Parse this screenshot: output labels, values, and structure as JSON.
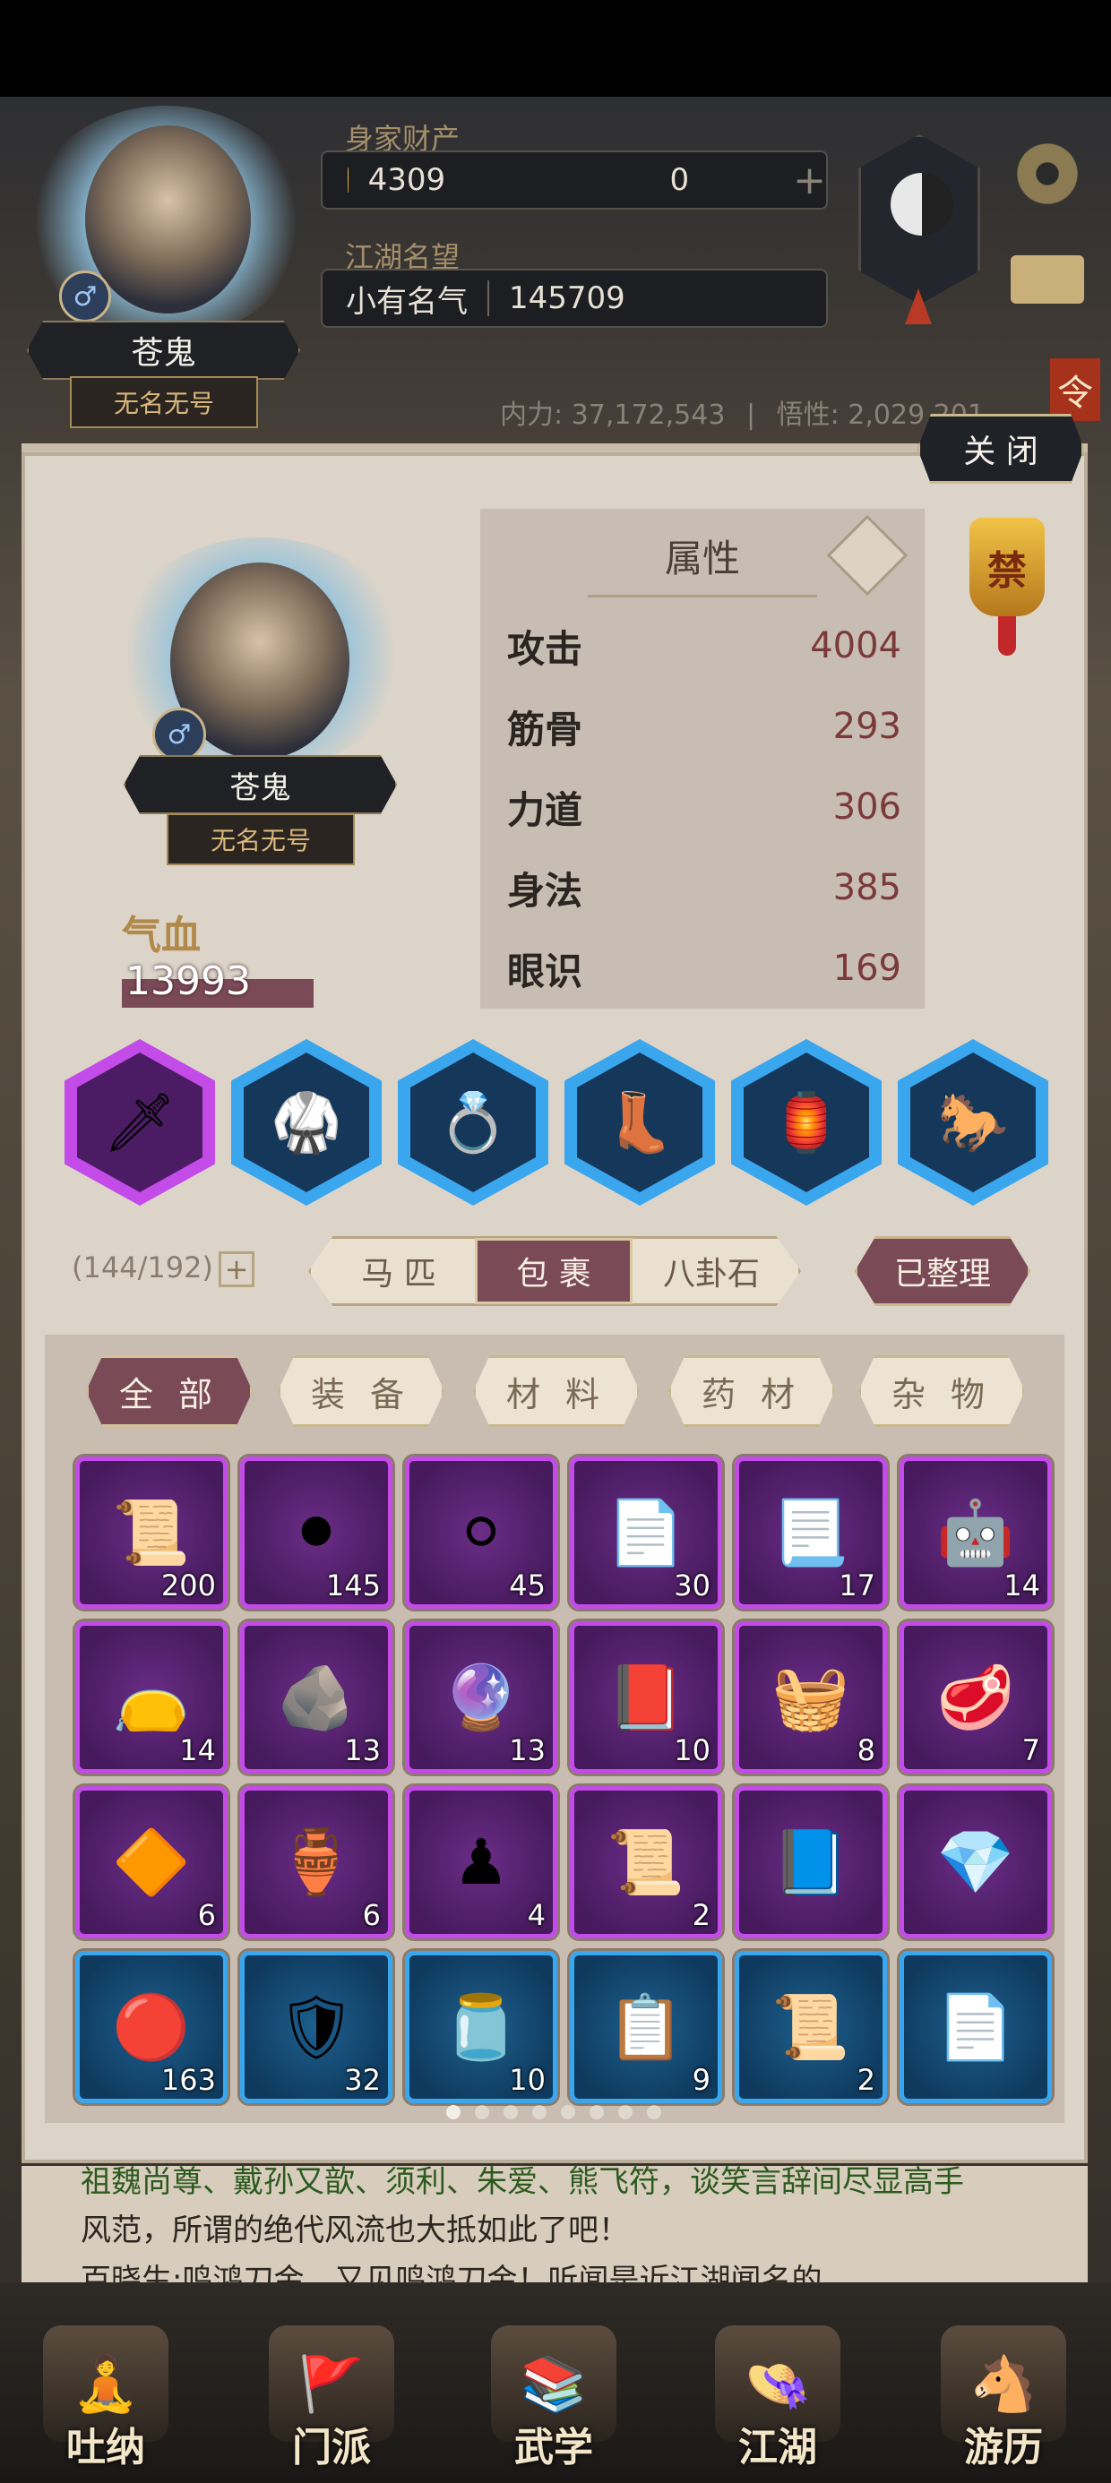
{
  "header": {
    "char_name": "苍鬼",
    "char_title": "无名无号",
    "gender_symbol": "♂",
    "wealth_label": "身家财产",
    "gold": "4309",
    "jade": "0",
    "add_symbol": "+",
    "fame_label": "江湖名望",
    "fame_level": "小有名气",
    "fame_value": "145709",
    "inner_power_label": "内力:",
    "inner_power": "37,172,543",
    "comprehension_label": "悟性:",
    "comprehension": "2,029,201",
    "side_badge": "令"
  },
  "modal": {
    "close_label": "关 闭",
    "char_name": "苍鬼",
    "char_title": "无名无号",
    "gender_symbol": "♂",
    "hp_label": "气血",
    "hp_value": "13993",
    "attr_title": "属性",
    "ban_badge": "禁",
    "attributes": [
      {
        "name": "攻击",
        "value": "4004"
      },
      {
        "name": "筋骨",
        "value": "293"
      },
      {
        "name": "力道",
        "value": "306"
      },
      {
        "name": "身法",
        "value": "385"
      },
      {
        "name": "眼识",
        "value": "169"
      }
    ],
    "equipment": [
      {
        "icon": "spear-icon",
        "glyph": "🗡",
        "rarity": "purple"
      },
      {
        "icon": "armor-icon",
        "glyph": "🥋",
        "rarity": "blue"
      },
      {
        "icon": "bracelet-icon",
        "glyph": "💍",
        "rarity": "blue"
      },
      {
        "icon": "boots-icon",
        "glyph": "👢",
        "rarity": "blue"
      },
      {
        "icon": "pendant-icon",
        "glyph": "🏮",
        "rarity": "blue"
      },
      {
        "icon": "horse-icon",
        "glyph": "🐎",
        "rarity": "blue"
      }
    ],
    "capacity": "(144/192)",
    "capacity_add": "+",
    "tabs": [
      "马 匹",
      "包 裹",
      "八卦石"
    ],
    "active_tab": 1,
    "sorted_label": "已整理",
    "categories": [
      "全 部",
      "装 备",
      "材 料",
      "药 材",
      "杂 物"
    ],
    "active_category": 0,
    "items": [
      {
        "icon": "scroll-icon",
        "glyph": "📜",
        "count": "200",
        "rarity": "purple"
      },
      {
        "icon": "black-jade-ring-icon",
        "glyph": "⚫",
        "count": "145",
        "rarity": "purple"
      },
      {
        "icon": "pearl-icon",
        "glyph": "⚪",
        "count": "45",
        "rarity": "purple"
      },
      {
        "icon": "letter-icon",
        "glyph": "📄",
        "count": "30",
        "rarity": "purple"
      },
      {
        "icon": "manuscript-icon",
        "glyph": "📃",
        "count": "17",
        "rarity": "purple"
      },
      {
        "icon": "golden-puppet-icon",
        "glyph": "🤖",
        "count": "14",
        "rarity": "purple"
      },
      {
        "icon": "purple-pouch-icon",
        "glyph": "👝",
        "count": "14",
        "rarity": "purple"
      },
      {
        "icon": "stone-tablet-icon",
        "glyph": "🪨",
        "count": "13",
        "rarity": "purple"
      },
      {
        "icon": "orb-icon",
        "glyph": "🔮",
        "count": "13",
        "rarity": "purple"
      },
      {
        "icon": "red-book-icon",
        "glyph": "📕",
        "count": "10",
        "rarity": "purple"
      },
      {
        "icon": "silk-cloth-icon",
        "glyph": "🧺",
        "count": "8",
        "rarity": "purple"
      },
      {
        "icon": "meat-icon",
        "glyph": "🥩",
        "count": "7",
        "rarity": "purple"
      },
      {
        "icon": "gold-shard-icon",
        "glyph": "🔶",
        "count": "6",
        "rarity": "purple"
      },
      {
        "icon": "wine-jar-icon",
        "glyph": "🏺",
        "count": "6",
        "rarity": "purple"
      },
      {
        "icon": "chess-board-icon",
        "glyph": "♟",
        "count": "4",
        "rarity": "purple"
      },
      {
        "icon": "old-paper-icon",
        "glyph": "📜",
        "count": "2",
        "rarity": "purple"
      },
      {
        "icon": "blue-book-icon",
        "glyph": "📘",
        "count": "",
        "rarity": "purple"
      },
      {
        "icon": "sapphire-icon",
        "glyph": "💎",
        "count": "",
        "rarity": "purple"
      },
      {
        "icon": "pink-orb-icon",
        "glyph": "🔴",
        "count": "163",
        "rarity": "blue"
      },
      {
        "icon": "horse-token-icon",
        "glyph": "🛡",
        "count": "32",
        "rarity": "blue"
      },
      {
        "icon": "blue-pouch-icon",
        "glyph": "🫙",
        "count": "10",
        "rarity": "blue"
      },
      {
        "icon": "sect-letter-icon",
        "glyph": "📋",
        "count": "9",
        "rarity": "blue"
      },
      {
        "icon": "red-scroll-icon",
        "glyph": "📜",
        "count": "2",
        "rarity": "blue"
      },
      {
        "icon": "parchment-icon",
        "glyph": "📄",
        "count": "",
        "rarity": "blue"
      }
    ],
    "page_dots": 8,
    "active_page": 0
  },
  "story": {
    "line1": "祖魏尚尊、戴孙又歆、须利、朱爱、熊飞符，谈笑言辞间尽显高手",
    "line2": "风范，所谓的绝代风流也大抵如此了吧！",
    "line3": "百晓生:鸣鸿刀金，又见鸣鸿刀金！听闻是近江湖闻名的"
  },
  "nav": [
    {
      "label": "吐纳",
      "icon": "meditation-icon",
      "glyph": "🧘"
    },
    {
      "label": "门派",
      "icon": "sect-flag-icon",
      "glyph": "🚩"
    },
    {
      "label": "武学",
      "icon": "martial-books-icon",
      "glyph": "📚"
    },
    {
      "label": "江湖",
      "icon": "bamboo-hat-icon",
      "glyph": "👒"
    },
    {
      "label": "游历",
      "icon": "travel-horse-icon",
      "glyph": "🐴"
    }
  ],
  "colors": {
    "purple_rarity": "#c34be8",
    "blue_rarity": "#3aa6ee",
    "active_tab": "#7b4a57",
    "stat_value": "#7b3a3a"
  }
}
